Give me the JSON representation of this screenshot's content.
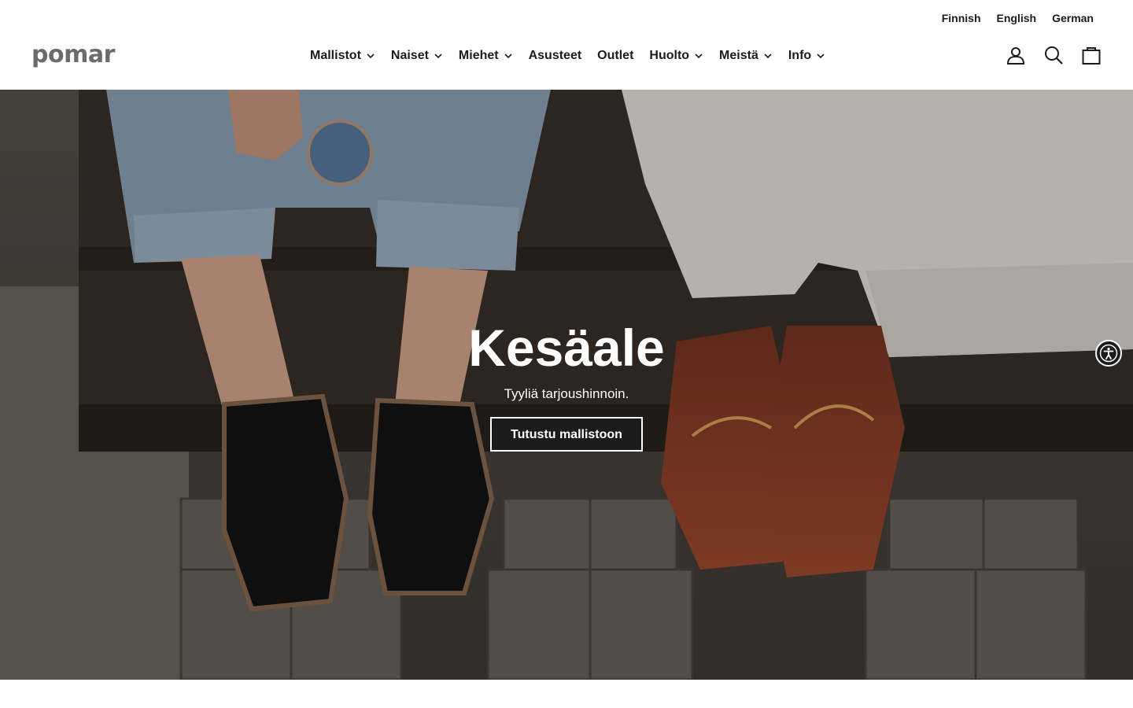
{
  "languages": [
    "Finnish",
    "English",
    "German"
  ],
  "brand": {
    "logo_text": "pomar"
  },
  "nav": {
    "items": [
      {
        "label": "Mallistot",
        "dropdown": true
      },
      {
        "label": "Naiset",
        "dropdown": true
      },
      {
        "label": "Miehet",
        "dropdown": true
      },
      {
        "label": "Asusteet",
        "dropdown": false
      },
      {
        "label": "Outlet",
        "dropdown": false
      },
      {
        "label": "Huolto",
        "dropdown": true
      },
      {
        "label": "Meistä",
        "dropdown": true
      },
      {
        "label": "Info",
        "dropdown": true
      }
    ]
  },
  "header_icons": [
    "account-icon",
    "search-icon",
    "cart-icon"
  ],
  "hero": {
    "title": "Kesäale",
    "subtitle": "Tyyliä tarjoushinnoin.",
    "cta_label": "Tutustu mallistoon"
  },
  "accessibility": {
    "icon": "accessibility-icon"
  },
  "colors": {
    "text": "#1c1c1c",
    "logo": "#6b6b6b",
    "button_bg": "#1c1c1c",
    "hero_text": "#ffffff"
  }
}
